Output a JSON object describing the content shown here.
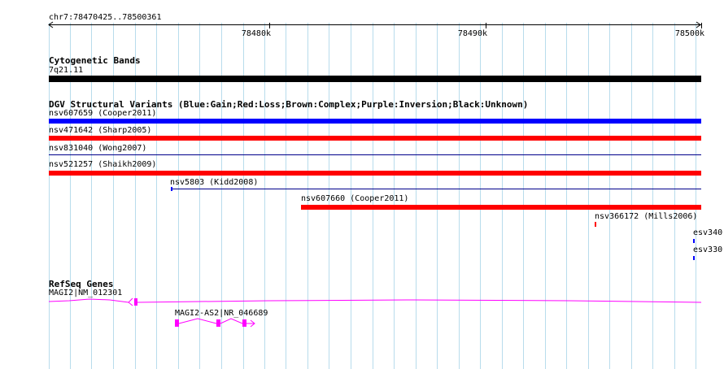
{
  "ruler": {
    "range_label": "chr7:78470425..78500361",
    "ticks": [
      "78480k",
      "78490k",
      "78500k"
    ]
  },
  "cytoband": {
    "title": "Cytogenetic Bands",
    "band_label": "7q21.11",
    "band_color": "#000000"
  },
  "dgv": {
    "title": "DGV Structural Variants (Blue:Gain;Red:Loss;Brown:Complex;Purple:Inversion;Black:Unknown)",
    "colors": {
      "gain": "#0000ff",
      "loss": "#ff0000",
      "thin_line": "#00008b"
    },
    "variants": [
      {
        "label": "nsv607659 (Cooper2011)",
        "type": "gain"
      },
      {
        "label": "nsv471642 (Sharp2005)",
        "type": "loss"
      },
      {
        "label": "nsv831040 (Wong2007)",
        "type": "thin"
      },
      {
        "label": "nsv521257 (Shaikh2009)",
        "type": "loss"
      },
      {
        "label": "nsv5803 (Kidd2008)",
        "type": "thin"
      },
      {
        "label": "nsv607660 (Cooper2011)",
        "type": "loss"
      },
      {
        "label": "nsv366172 (Mills2006)",
        "type": "loss"
      },
      {
        "label": "esv340",
        "type": "gain"
      },
      {
        "label": "esv330",
        "type": "gain"
      }
    ]
  },
  "refseq": {
    "title": "RefSeq Genes",
    "gene_color": "#ff00ff",
    "genes": [
      {
        "label": "MAGI2|NM_012301"
      },
      {
        "label": "MAGI2-AS2|NR_046689"
      }
    ]
  },
  "grid_color": "#b8dcec"
}
